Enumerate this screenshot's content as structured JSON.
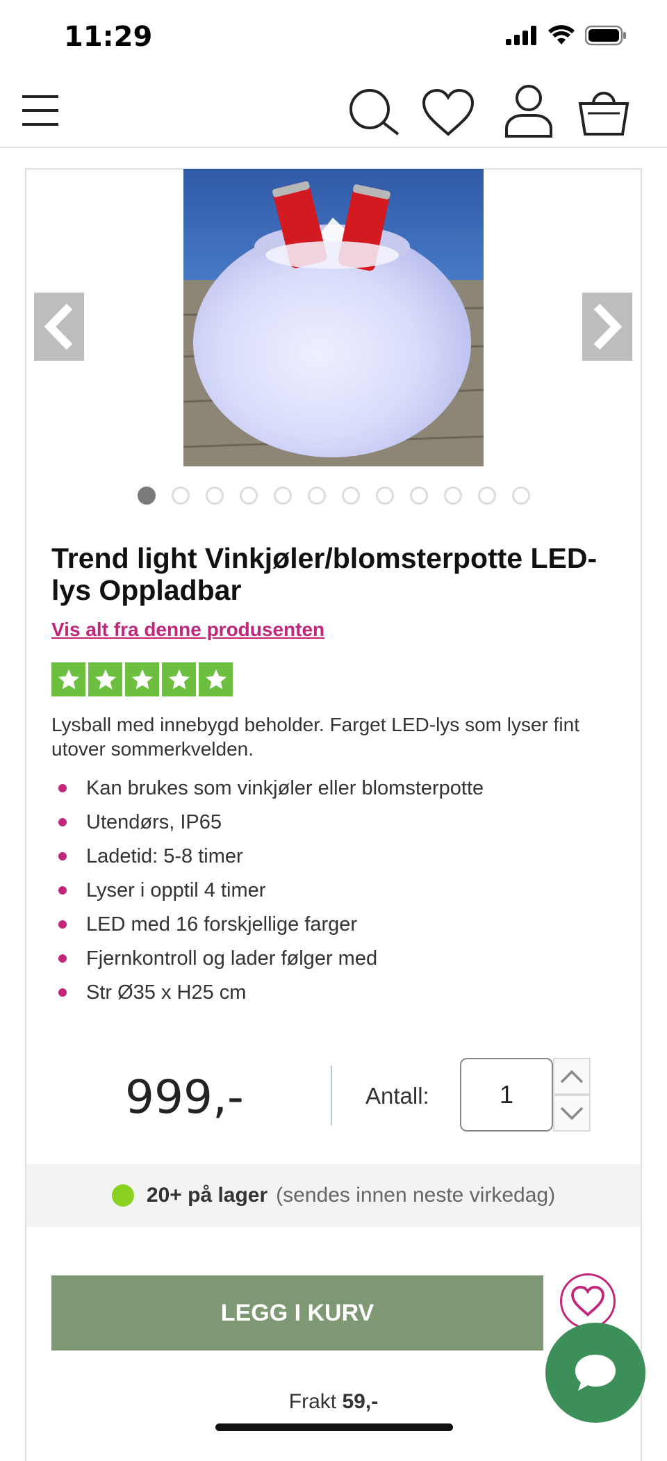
{
  "status_bar": {
    "time": "11:29"
  },
  "header": {
    "icons": [
      "menu-icon",
      "search-icon",
      "heart-icon",
      "user-icon",
      "basket-icon"
    ]
  },
  "gallery": {
    "image_description": "glowing white LED ball planter with two red cans in ice",
    "dot_count": 12,
    "active_index": 0
  },
  "product": {
    "title": "Trend light Vinkjøler/blomsterpotte LED-lys Oppladbar",
    "brand_link": "Vis alt fra denne produsenten",
    "rating": 5,
    "description": "Lysball med innebygd beholder. Farget LED-lys som lyser fint utover sommerkvelden.",
    "bullets": [
      "Kan brukes som vinkjøler eller blomsterpotte",
      "Utendørs, IP65",
      "Ladetid: 5-8 timer",
      "Lyser i opptil 4 timer",
      "LED med 16 forskjellige farger",
      "Fjernkontroll og lader følger med",
      "Str Ø35 x H25 cm"
    ]
  },
  "purchase": {
    "price": "999,-",
    "qty_label": "Antall:",
    "qty_value": "1",
    "stock_strong": "20+ på lager",
    "stock_rest": "(sendes innen neste virkedag)",
    "add_to_cart": "LEGG I KURV",
    "shipping_label": "Frakt",
    "shipping_value": "59,-"
  },
  "colors": {
    "accent_pink": "#c2267a",
    "button_green": "#7f9874",
    "star_green": "#6cbf3f",
    "stock_green": "#8bd120",
    "chat_green": "#3d8f5a"
  }
}
